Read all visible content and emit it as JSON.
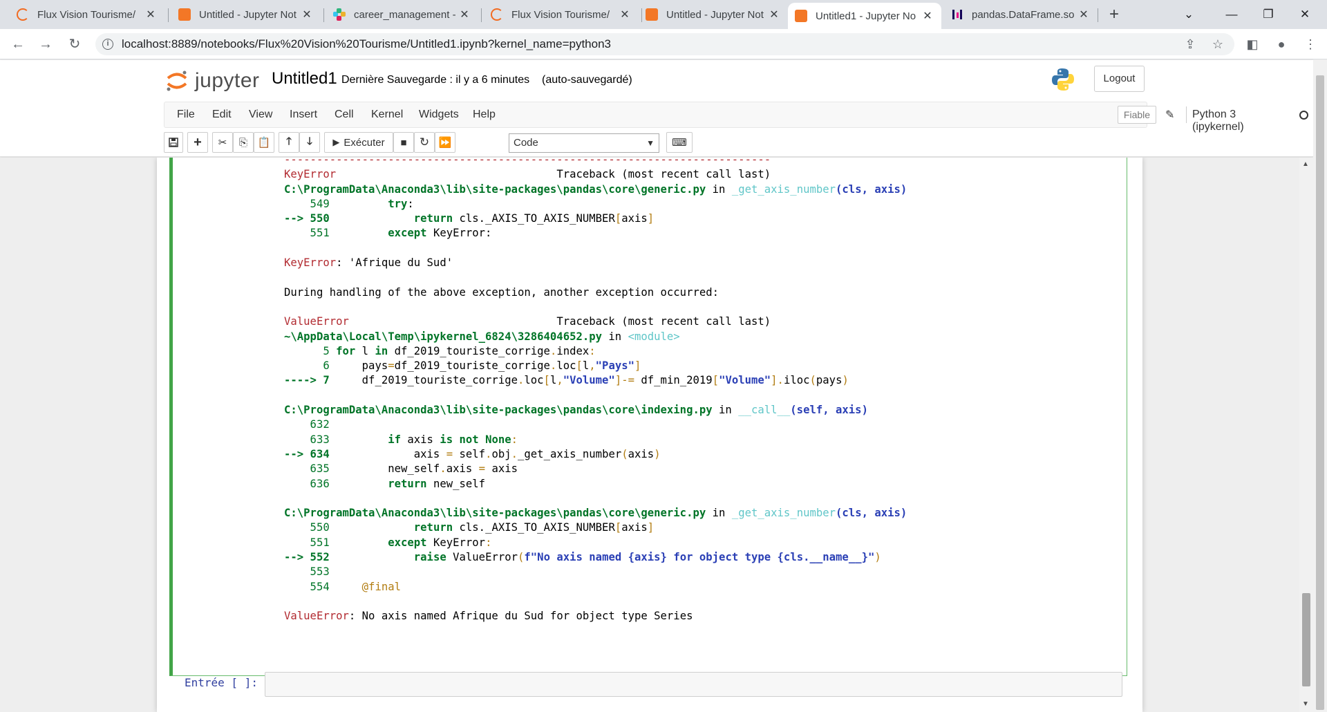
{
  "browser": {
    "tabs": [
      {
        "title": "Flux Vision Tourisme/",
        "icon": "flux-icon"
      },
      {
        "title": "Untitled - Jupyter Not",
        "icon": "jupyter-icon"
      },
      {
        "title": "career_management -",
        "icon": "slack-icon"
      },
      {
        "title": "Flux Vision Tourisme/",
        "icon": "flux-icon"
      },
      {
        "title": "Untitled - Jupyter Not",
        "icon": "jupyter-icon"
      },
      {
        "title": "Untitled1 - Jupyter No",
        "icon": "jupyter-icon",
        "active": true
      },
      {
        "title": "pandas.DataFrame.so",
        "icon": "pandas-icon"
      }
    ],
    "new_tab": "+",
    "url": "localhost:8889/notebooks/Flux%20Vision%20Tourisme/Untitled1.ipynb?kernel_name=python3"
  },
  "jupyter": {
    "logo_text": "jupyter",
    "notebook_name": "Untitled1",
    "save_status": "Dernière Sauvegarde : il y a 6 minutes",
    "autosave": "(auto-sauvegardé)",
    "logout": "Logout",
    "menu": [
      "File",
      "Edit",
      "View",
      "Insert",
      "Cell",
      "Kernel",
      "Widgets",
      "Help"
    ],
    "trusted": "Fiable",
    "kernel": "Python 3 (ipykernel)",
    "run_label": "Exécuter",
    "cell_type": "Code",
    "next_prompt": "Entrée [ ]:"
  },
  "traceback": {
    "separator": "---------------------------------------------------------------------------",
    "tb_header": "Traceback (most recent call last)",
    "err1": {
      "name": "KeyError",
      "file": "C:\\ProgramData\\Anaconda3\\lib\\site-packages\\pandas\\core\\generic.py",
      "func": "_get_axis_number",
      "args": "(cls, axis)",
      "msg": ": 'Afrique du Sud'"
    },
    "during": "During handling of the above exception, another exception occurred:",
    "err2": {
      "name": "ValueError",
      "file": "~\\AppData\\Local\\Temp\\ipykernel_6824\\3286404652.py",
      "module": "<module>"
    },
    "frame_indexing": {
      "file": "C:\\ProgramData\\Anaconda3\\lib\\site-packages\\pandas\\core\\indexing.py",
      "func": "__call__",
      "args": "(self, axis)"
    },
    "frame_generic": {
      "file": "C:\\ProgramData\\Anaconda3\\lib\\site-packages\\pandas\\core\\generic.py",
      "func": "_get_axis_number",
      "args": "(cls, axis)"
    },
    "final_msg": ": No axis named Afrique du Sud for object type Series",
    "in_word": "in"
  }
}
